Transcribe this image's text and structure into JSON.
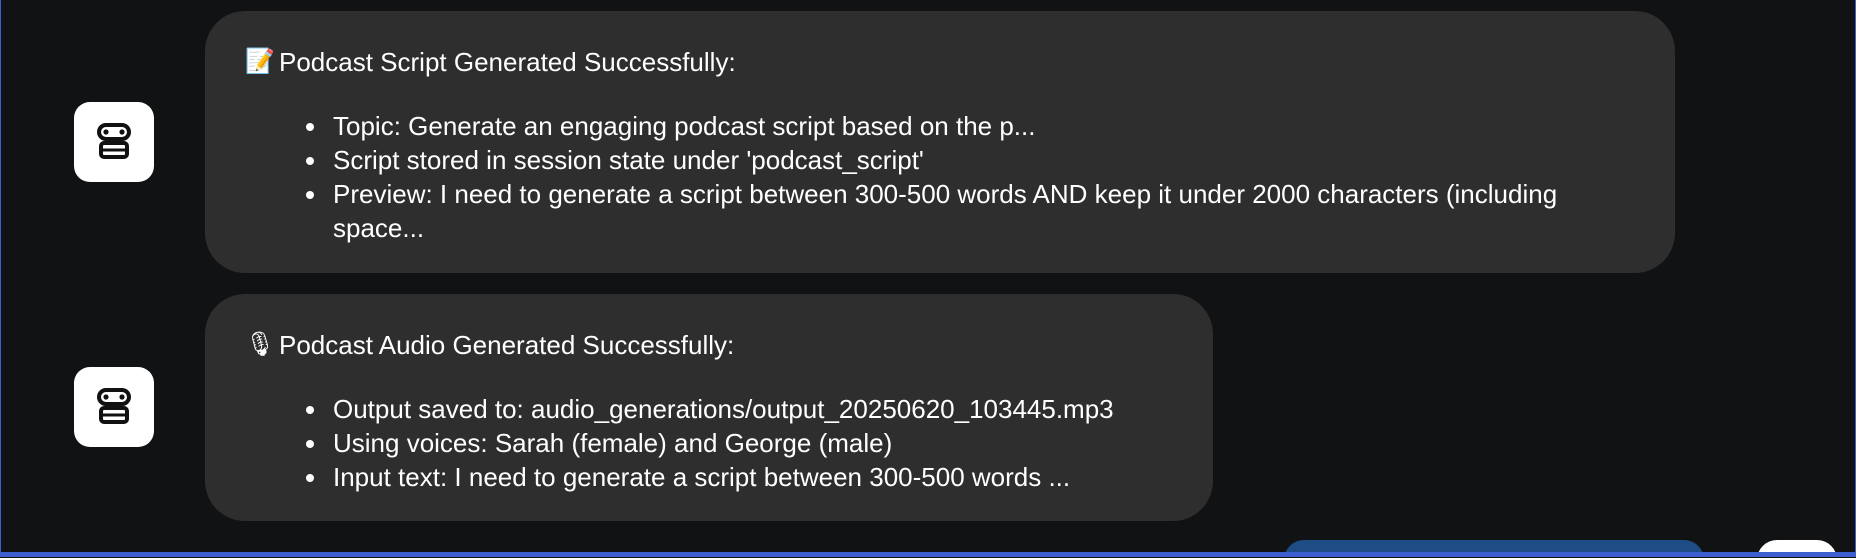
{
  "messages": [
    {
      "icon": "memo-emoji-icon",
      "emoji": "📝",
      "heading": "Podcast Script Generated Successfully:",
      "items": [
        "Topic: Generate an engaging podcast script based on the p...",
        "Script stored in session state under 'podcast_script'",
        "Preview: I need to generate a script between 300-500 words AND keep it under 2000 characters (including space..."
      ]
    },
    {
      "icon": "microphone-emoji-icon",
      "emoji": "🎙",
      "heading": "Podcast Audio Generated Successfully:",
      "items": [
        "Output saved to: audio_generations/output_20250620_103445.mp3",
        "Using voices: Sarah (female) and George (male)",
        "Input text: I need to generate a script between 300-500 words ..."
      ]
    }
  ],
  "colors": {
    "background": "#111214",
    "bubble": "#2e2e2f",
    "avatar": "#ffffff",
    "frame_accent": "#3d5fd0",
    "user_bubble_partial": "#1e4d86"
  }
}
